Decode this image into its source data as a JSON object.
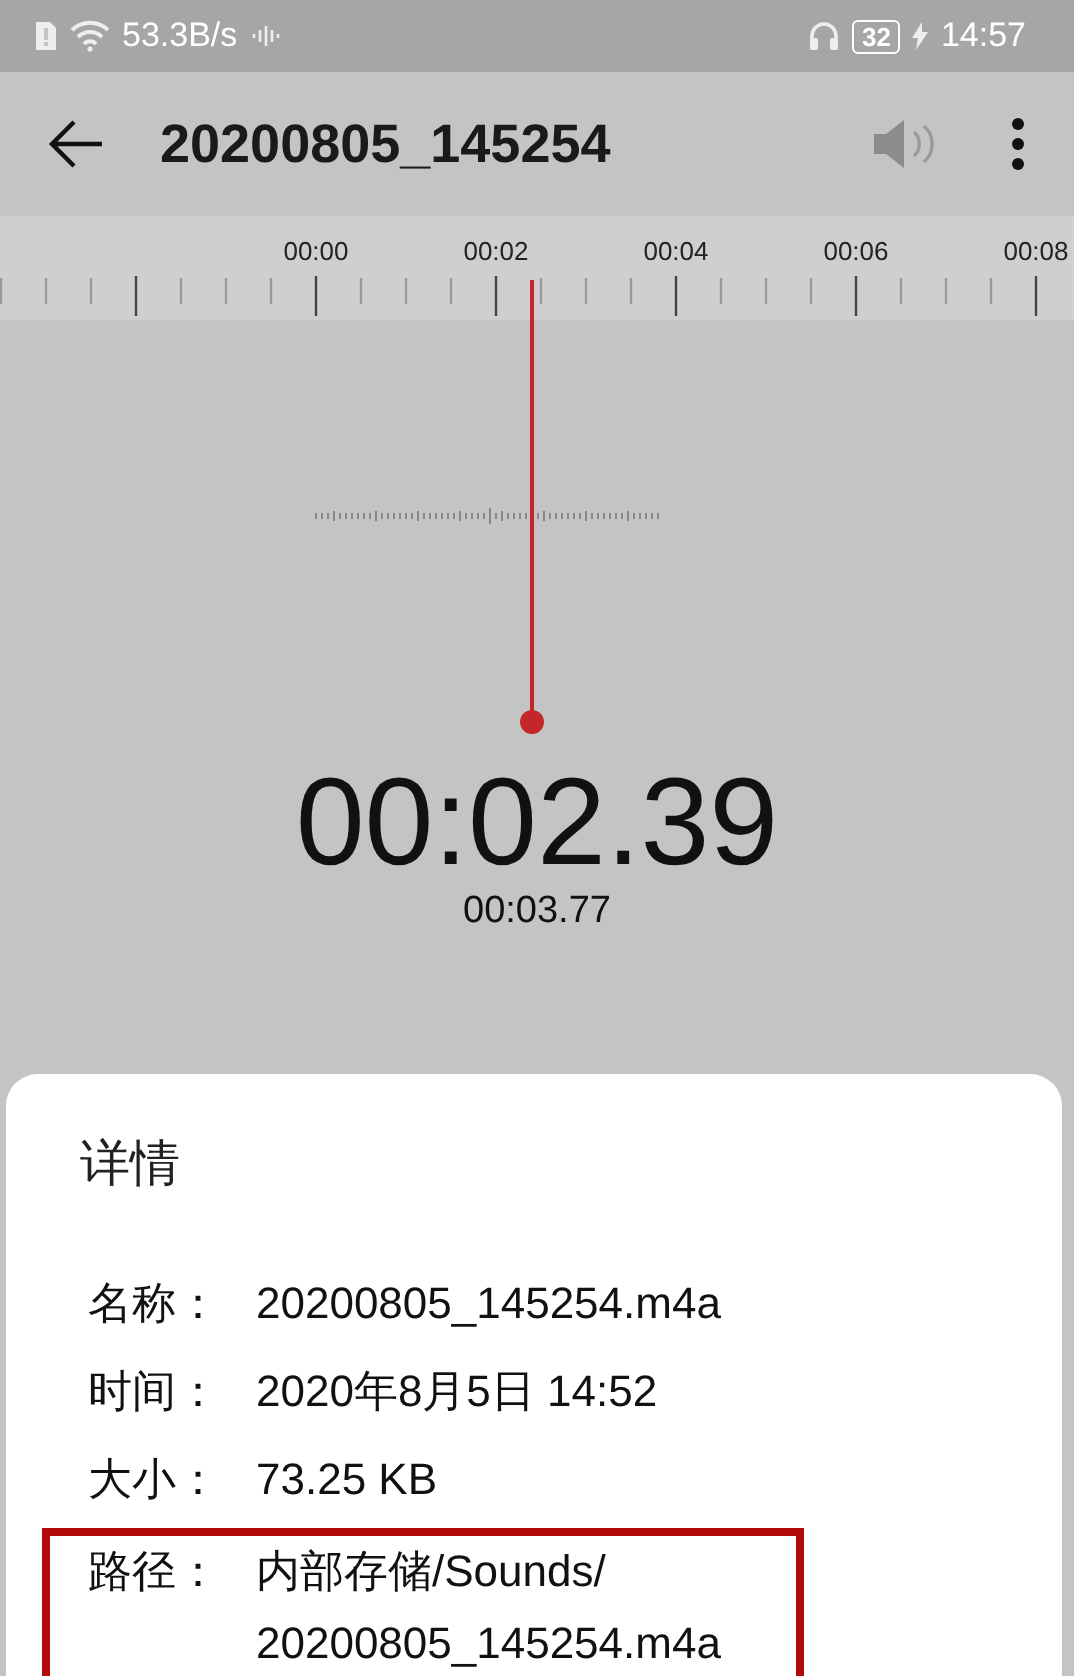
{
  "status_bar": {
    "network_speed": "53.3B/s",
    "battery": "32",
    "charging": true,
    "time": "14:57"
  },
  "toolbar": {
    "title": "20200805_145254"
  },
  "ruler": {
    "labels": [
      "00:00",
      "00:02",
      "00:04",
      "00:06",
      "00:08"
    ]
  },
  "playback": {
    "position": "00:02.39",
    "duration": "00:03.77"
  },
  "details": {
    "title": "详情",
    "rows": [
      {
        "label": "名称：",
        "lines": [
          "20200805_145254.m4a"
        ],
        "highlighted": false
      },
      {
        "label": "时间：",
        "lines": [
          "2020年8月5日 14:52"
        ],
        "highlighted": false
      },
      {
        "label": "大小：",
        "lines": [
          "73.25 KB"
        ],
        "highlighted": false
      },
      {
        "label": "路径：",
        "lines": [
          "内部存储/Sounds/",
          "20200805_145254.m4a"
        ],
        "highlighted": true
      }
    ]
  }
}
